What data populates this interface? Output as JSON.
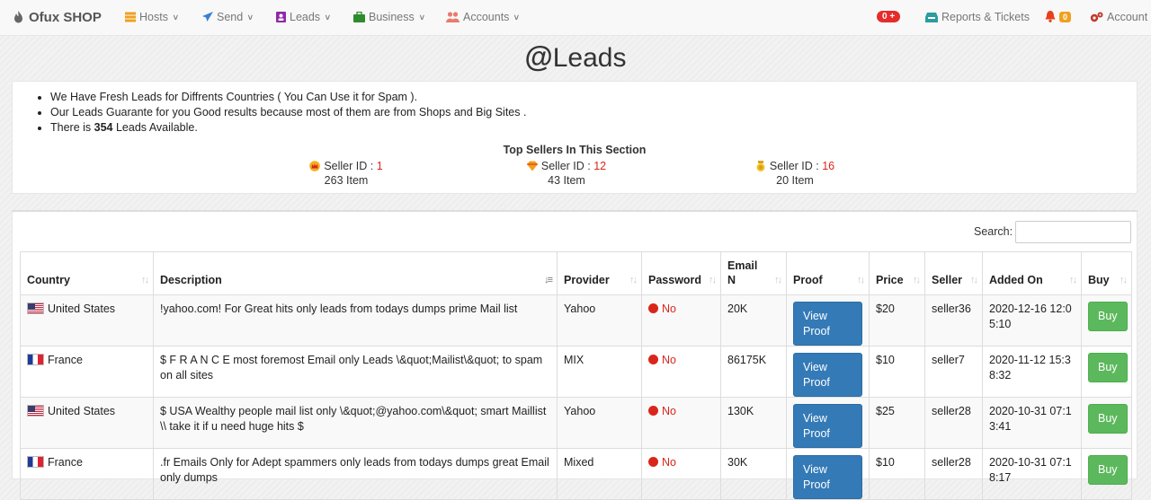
{
  "nav": {
    "brand": "Ofux SHOP",
    "items": [
      {
        "label": "Hosts",
        "icon": "server-icon"
      },
      {
        "label": "Send",
        "icon": "paper-plane-icon"
      },
      {
        "label": "Leads",
        "icon": "address-book-icon"
      },
      {
        "label": "Business",
        "icon": "briefcase-icon"
      },
      {
        "label": "Accounts",
        "icon": "users-icon"
      }
    ],
    "balance_badge": "0 +",
    "reports": "Reports & Tickets",
    "notif_count": "0",
    "account": "Account"
  },
  "page": {
    "title_symbol": "@",
    "title": "Leads"
  },
  "info": {
    "line1": "We Have Fresh Leads for Diffrents Countries ( You Can Use it for Spam ).",
    "line2": "Our Leads Guarante for you Good results because most of them are from Shops and Big Sites .",
    "line3_pre": "There is",
    "line3_count": "354",
    "line3_post": "Leads Available.",
    "top_sellers_title": "Top Sellers In This Section",
    "sellers": [
      {
        "label": "Seller ID :",
        "id": "1",
        "items": "263 Item"
      },
      {
        "label": "Seller ID :",
        "id": "12",
        "items": "43 Item"
      },
      {
        "label": "Seller ID :",
        "id": "16",
        "items": "20 Item"
      }
    ]
  },
  "table": {
    "search_label": "Search:",
    "columns": [
      "Country",
      "Description",
      "Provider",
      "Password",
      "Email N",
      "Proof",
      "Price",
      "Seller",
      "Added On",
      "Buy"
    ],
    "rows": [
      {
        "country": "United States",
        "flag": "us",
        "description": "!yahoo.com! For Great hits only leads from todays dumps prime Mail list",
        "provider": "Yahoo",
        "password": "No",
        "email_n": "20K",
        "proof": "View Proof",
        "price": "$20",
        "seller": "seller36",
        "added_on": "2020-12-16 12:05:10",
        "buy": "Buy"
      },
      {
        "country": "France",
        "flag": "fr",
        "description": "$ F R A N C E most foremost Email only Leads \\&quot;Mailist\\&quot; to spam on all sites",
        "provider": "MIX",
        "password": "No",
        "email_n": "86175K",
        "proof": "View Proof",
        "price": "$10",
        "seller": "seller7",
        "added_on": "2020-11-12 15:38:32",
        "buy": "Buy"
      },
      {
        "country": "United States",
        "flag": "us",
        "description": "$ USA Wealthy people mail list only \\&quot;@yahoo.com\\&quot; smart Maillist \\\\ take it if u need huge hits $",
        "provider": "Yahoo",
        "password": "No",
        "email_n": "130K",
        "proof": "View Proof",
        "price": "$25",
        "seller": "seller28",
        "added_on": "2020-10-31 07:13:41",
        "buy": "Buy"
      },
      {
        "country": "France",
        "flag": "fr",
        "description": ".fr Emails Only for Adept spammers only leads from todays dumps great Email only dumps",
        "provider": "Mixed",
        "password": "No",
        "email_n": "30K",
        "proof": "View Proof",
        "price": "$10",
        "seller": "seller28",
        "added_on": "2020-10-31 07:18:17",
        "buy": "Buy"
      }
    ]
  },
  "colors": {
    "primary": "#337ab7",
    "success": "#5cb85c",
    "danger": "#d9261c",
    "warning": "#f0a020"
  }
}
